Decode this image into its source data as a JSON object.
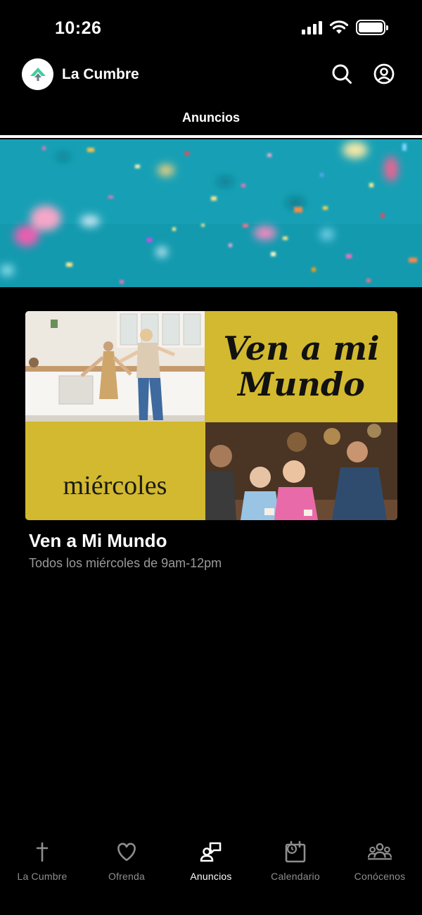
{
  "status": {
    "time": "10:26"
  },
  "header": {
    "title": "La Cumbre",
    "logo_icon": "mountain-logo-icon",
    "search_icon": "search-icon",
    "profile_icon": "user-circle-icon"
  },
  "tab": {
    "label": "Anuncios"
  },
  "event": {
    "image_title_line1": "Ven a mi",
    "image_title_line2": "Mundo",
    "image_day": "miércoles",
    "title": "Ven a Mi Mundo",
    "subtitle": "Todos los miércoles de 9am-12pm"
  },
  "nav": {
    "items": [
      {
        "label": "La Cumbre",
        "icon": "cross-icon",
        "active": false
      },
      {
        "label": "Ofrenda",
        "icon": "heart-icon",
        "active": false
      },
      {
        "label": "Anuncios",
        "icon": "announcements-icon",
        "active": true
      },
      {
        "label": "Calendario",
        "icon": "calendar-icon",
        "active": false
      },
      {
        "label": "Conócenos",
        "icon": "people-icon",
        "active": false
      }
    ]
  },
  "colors": {
    "background": "#000000",
    "hero": "#1aa3b8",
    "accent_yellow": "#d2b92f",
    "inactive": "#8e8e8e",
    "logo_green": "#3ecf9a"
  }
}
